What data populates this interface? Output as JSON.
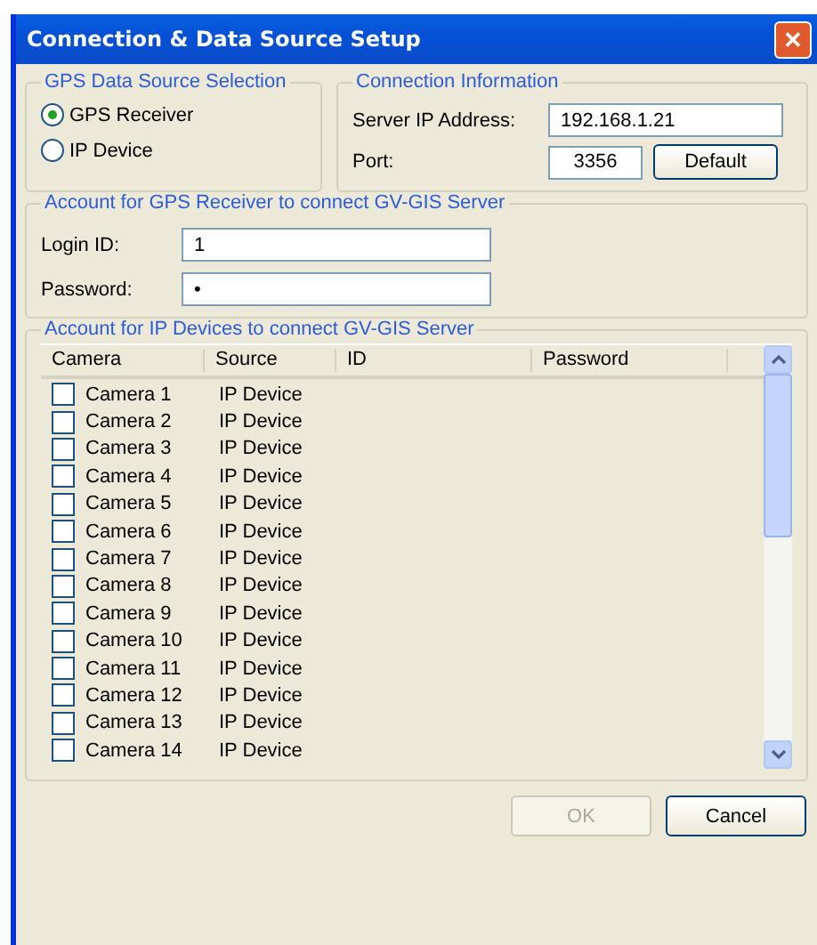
{
  "window": {
    "title": "Connection & Data Source Setup",
    "close": "✕"
  },
  "gps_source": {
    "legend": "GPS Data Source Selection",
    "options": [
      {
        "label": "GPS Receiver",
        "selected": true
      },
      {
        "label": "IP Device",
        "selected": false
      }
    ]
  },
  "connection": {
    "legend": "Connection Information",
    "server_label": "Server IP Address:",
    "server_value": "192.168.1.21",
    "port_label": "Port:",
    "port_value": "3356",
    "default_button": "Default"
  },
  "receiver_account": {
    "legend": "Account for GPS Receiver to connect GV-GIS Server",
    "login_label": "Login ID:",
    "login_value": "1",
    "password_label": "Password:",
    "password_value": "•"
  },
  "ip_accounts": {
    "legend": "Account for IP Devices to connect GV-GIS Server",
    "columns": [
      "Camera",
      "Source",
      "ID",
      "Password"
    ],
    "rows": [
      {
        "camera": "Camera 1",
        "source": "IP Device",
        "checked": false
      },
      {
        "camera": "Camera 2",
        "source": "IP Device",
        "checked": false
      },
      {
        "camera": "Camera 3",
        "source": "IP Device",
        "checked": false
      },
      {
        "camera": "Camera 4",
        "source": "IP Device",
        "checked": false
      },
      {
        "camera": "Camera 5",
        "source": "IP Device",
        "checked": false
      },
      {
        "camera": "Camera 6",
        "source": "IP Device",
        "checked": false
      },
      {
        "camera": "Camera 7",
        "source": "IP Device",
        "checked": false
      },
      {
        "camera": "Camera 8",
        "source": "IP Device",
        "checked": false
      },
      {
        "camera": "Camera 9",
        "source": "IP Device",
        "checked": false
      },
      {
        "camera": "Camera 10",
        "source": "IP Device",
        "checked": false
      },
      {
        "camera": "Camera 11",
        "source": "IP Device",
        "checked": false
      },
      {
        "camera": "Camera 12",
        "source": "IP Device",
        "checked": false
      },
      {
        "camera": "Camera 13",
        "source": "IP Device",
        "checked": false
      },
      {
        "camera": "Camera 14",
        "source": "IP Device",
        "checked": false
      }
    ]
  },
  "buttons": [
    {
      "label": "OK",
      "disabled": true
    },
    {
      "label": "Cancel",
      "disabled": false
    }
  ]
}
